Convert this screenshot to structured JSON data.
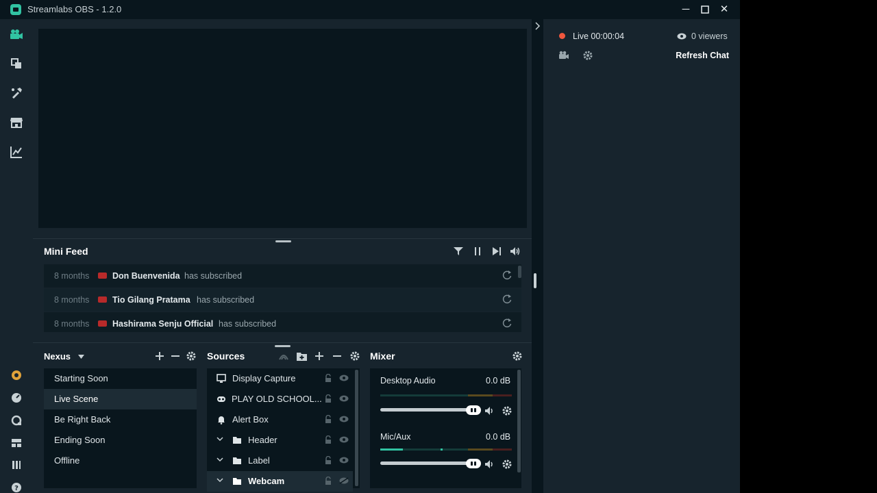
{
  "window": {
    "title": "Streamlabs OBS - 1.2.0",
    "minimize_glyph": "─",
    "maximize_glyph": "☐",
    "close_glyph": "✕"
  },
  "nav": {
    "top_icons": [
      "studio-camera-icon",
      "layout-editor-icon",
      "theme-brush-icon",
      "store-icon",
      "analytics-chart-icon"
    ],
    "bottom_icons": [
      "prime-star-icon",
      "dashboard-icon",
      "help-chat-icon",
      "layout-icon",
      "studio-mode-icon",
      "help-icon"
    ]
  },
  "minifeed": {
    "title": "Mini Feed",
    "items": [
      {
        "when": "8 months",
        "name": "Don Buenvenida",
        "action": "has subscribed"
      },
      {
        "when": "8 months",
        "name": "Tio Gilang Pratama",
        "action": "has subscribed"
      },
      {
        "when": "8 months",
        "name": "Hashirama Senju Official",
        "action": "has subscribed"
      }
    ]
  },
  "scenes": {
    "collection": "Nexus",
    "items": [
      "Starting Soon",
      "Live Scene",
      "Be Right Back",
      "Ending Soon",
      "Offline"
    ],
    "active_index": 1
  },
  "sources": {
    "title": "Sources",
    "items": [
      {
        "label": "Display Capture",
        "icon": "monitor-icon",
        "folder": false
      },
      {
        "label": "PLAY OLD SCHOOL...",
        "icon": "gamepad-icon",
        "folder": false
      },
      {
        "label": "Alert Box",
        "icon": "bell-icon",
        "folder": false
      },
      {
        "label": "Header",
        "icon": "folder-icon",
        "folder": true
      },
      {
        "label": "Label",
        "icon": "folder-icon",
        "folder": true
      },
      {
        "label": "Webcam",
        "icon": "folder-icon",
        "folder": true
      }
    ],
    "active_index": 5
  },
  "mixer": {
    "title": "Mixer",
    "channels": [
      {
        "name": "Desktop Audio",
        "db": "0.0 dB",
        "level": 0.0
      },
      {
        "name": "Mic/Aux",
        "db": "0.0 dB",
        "level": 0.17
      }
    ]
  },
  "chat": {
    "live_label": "Live 00:00:04",
    "viewers": "0 viewers",
    "refresh_label": "Refresh Chat"
  },
  "colors": {
    "accent": "#31c3a2",
    "live": "#f0573e",
    "youtube": "#b82a2a"
  }
}
